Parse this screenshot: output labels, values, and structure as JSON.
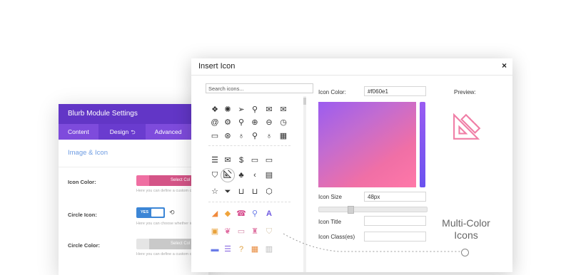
{
  "blurb": {
    "title": "Blurb Module Settings",
    "tabs": [
      {
        "label": "Content"
      },
      {
        "label": "Design",
        "suffix": "⮌"
      },
      {
        "label": "Advanced"
      }
    ],
    "section_title": "Image & Icon",
    "rows": [
      {
        "label": "Icon Color:",
        "control_text": "Select Col",
        "help": "Here you can define a custom col"
      },
      {
        "label": "Circle Icon:",
        "toggle_text": "YES",
        "help": "Here you can choose whether ico"
      },
      {
        "label": "Circle Color:",
        "control_text": "Select Col",
        "help": "Here you can define a custom col"
      }
    ]
  },
  "modal": {
    "title": "Insert Icon",
    "close_label": "×",
    "search_placeholder": "Search icons...",
    "icon_color_label": "Icon Color:",
    "icon_color_value": "#f060e1",
    "preview_label": "Preview:",
    "icon_size_label": "Icon Size",
    "icon_size_value": "48px",
    "icon_size_slider": 0.28,
    "icon_title_label": "Icon Title",
    "icon_title_value": "",
    "icon_class_label": "Icon Class(es)",
    "icon_class_value": ""
  },
  "colors": {
    "accent_purple": "#6236c6",
    "tab_purple": "#7e4bdc",
    "icon_pink": "#f060e1",
    "preview_pink": "#f07ea6"
  },
  "callout": {
    "line1": "Multi-Color",
    "line2": "Icons"
  }
}
